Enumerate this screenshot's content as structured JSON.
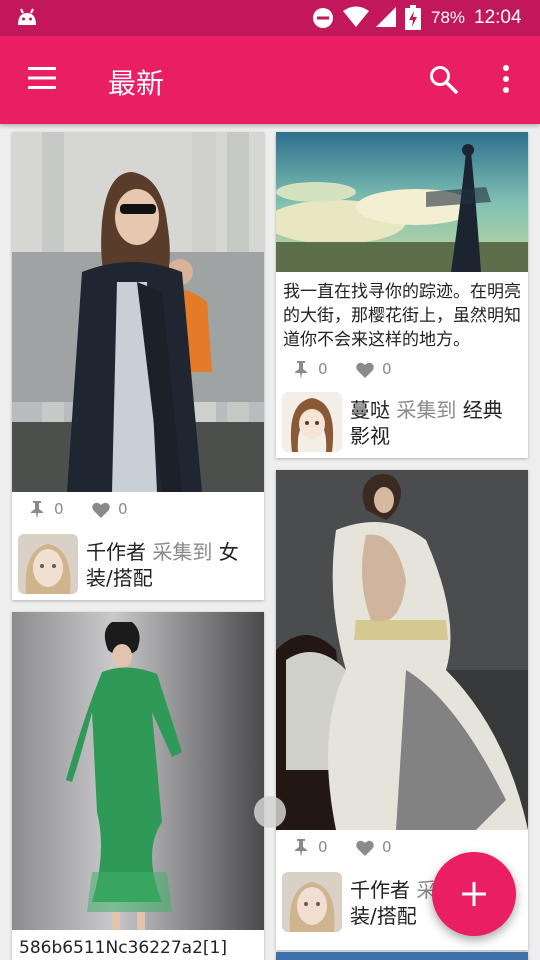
{
  "status_bar": {
    "battery": "78%",
    "time": "12:04"
  },
  "toolbar": {
    "title": "最新",
    "menu_icon": "hamburger-menu-icon",
    "search_icon": "search-icon",
    "more_icon": "more-vert-icon"
  },
  "colors": {
    "primary": "#e91e63",
    "primary_dark": "#c2185b",
    "background": "#eeeeee",
    "secondary_text": "#8a8a8a"
  },
  "cards": [
    {
      "image": "woman in navy coat with sunglasses on street",
      "pins": "0",
      "likes": "0",
      "collector": "千作者",
      "verb": "采集到",
      "board": "女装/搭配"
    },
    {
      "image": "anime style painting of clouds and silhouette",
      "caption": "我一直在找寻你的踪迹。在明亮的大街，那樱花街上，虽然明知道你不会来这样的地方。",
      "pins": "0",
      "likes": "0",
      "collector": "蔓哒",
      "verb": "采集到",
      "board": "经典影视"
    },
    {
      "image": "woman in green dress",
      "caption": "586b6511Nc36227a2[1]"
    },
    {
      "image": "woman in embroidered lace gown seated",
      "pins": "0",
      "likes": "0",
      "collector": "千作者",
      "verb": "采集到",
      "board": "女装/搭配"
    }
  ],
  "fab": {
    "icon": "plus-icon"
  }
}
